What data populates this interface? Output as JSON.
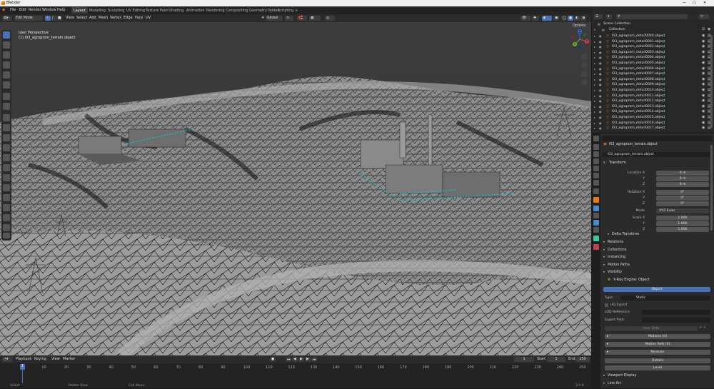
{
  "window": {
    "title": "Blender"
  },
  "menu": [
    "File",
    "Edit",
    "Render",
    "Window",
    "Help"
  ],
  "workspaces": [
    "Layout",
    "Modeling",
    "Sculpting",
    "UV Editing",
    "Texture Paint",
    "Shading",
    "Animation",
    "Rendering",
    "Compositing",
    "Geometry Nodes",
    "Scripting",
    "+"
  ],
  "scene": {
    "label": "Scene",
    "viewlayer": "ViewLayer"
  },
  "viewport": {
    "mode": "Edit Mode",
    "menus": [
      "View",
      "Select",
      "Add",
      "Mesh",
      "Vertex",
      "Edge",
      "Face",
      "UV"
    ],
    "orientation": "Global",
    "options_label": "Options",
    "perspective": "User Perspective",
    "object_name": "(1) l03_agroprom_terrain.object",
    "colors": {
      "bg": "#3a3a3a",
      "wire": "#0d0d0d",
      "mesh": "#9a9a9a",
      "accent": "#00c8c8"
    }
  },
  "gizmo": {
    "x": "X",
    "y": "Y",
    "z": "Z"
  },
  "timeline": {
    "menus": [
      "Playback",
      "Keying",
      "View",
      "Marker"
    ],
    "current_frame": "1",
    "start_label": "Start",
    "start": "1",
    "end_label": "End",
    "end": "250",
    "playhead": "1",
    "frames": [
      "10",
      "20",
      "30",
      "40",
      "50",
      "60",
      "70",
      "80",
      "90",
      "100",
      "110",
      "120",
      "130",
      "140",
      "150",
      "160",
      "170",
      "180",
      "190",
      "200",
      "210",
      "220",
      "230",
      "240",
      "250"
    ]
  },
  "statusbar": {
    "select": "Select",
    "rotate": "Rotate View",
    "call_menu": "Call Menu",
    "version": "3.5.0"
  },
  "outliner": {
    "scene_collection": "Scene Collection",
    "collection": "Collection",
    "items": [
      "l03_agroprom_detail0000.object",
      "l03_agroprom_detail0001.object",
      "l03_agroprom_detail0002.object",
      "l03_agroprom_detail0003.object",
      "l03_agroprom_detail0004.object",
      "l03_agroprom_detail0005.object",
      "l03_agroprom_detail0006.object",
      "l03_agroprom_detail0007.object",
      "l03_agroprom_detail0008.object",
      "l03_agroprom_detail0009.object",
      "l03_agroprom_detail0010.object",
      "l03_agroprom_detail0011.object",
      "l03_agroprom_detail0012.object",
      "l03_agroprom_detail0013.object",
      "l03_agroprom_detail0014.object",
      "l03_agroprom_detail0015.object",
      "l03_agroprom_detail0016.object",
      "l03_agroprom_detail0017.object"
    ]
  },
  "properties": {
    "object_title": "l03_agroprom_terrain.object",
    "object_field": "l03_agroprom_terrain.object",
    "transform": "Transform",
    "location": {
      "label_x": "Location X",
      "label_y": "Y",
      "label_z": "Z",
      "x": "0 m",
      "y": "0 m",
      "z": "0 m"
    },
    "rotation": {
      "label_x": "Rotation X",
      "label_y": "Y",
      "label_z": "Z",
      "x": "0°",
      "y": "0°",
      "z": "0°"
    },
    "mode": {
      "label": "Mode",
      "value": "XYZ Euler"
    },
    "scale": {
      "label_x": "Scale X",
      "label_y": "Y",
      "label_z": "Z",
      "x": "1.000",
      "y": "1.000",
      "z": "1.000"
    },
    "sections": [
      "Delta Transform",
      "Relations",
      "Collections",
      "Instancing",
      "Motion Paths",
      "Visibility"
    ],
    "xray": {
      "title": "X-Ray Engine: Object",
      "tab": "Object",
      "type_label": "Type:",
      "type_value": "Static",
      "hq_export": "HQ Export",
      "lod_label": "LOD Reference:",
      "export_label": "Export Path:",
      "user_data": "User Data",
      "motions": "Motions (0)",
      "motion_refs": "Motion Refs (0)",
      "revision": "Revision",
      "details": "Details",
      "level": "Level"
    },
    "viewport_display": "Viewport Display",
    "line_art": "Line Art"
  }
}
